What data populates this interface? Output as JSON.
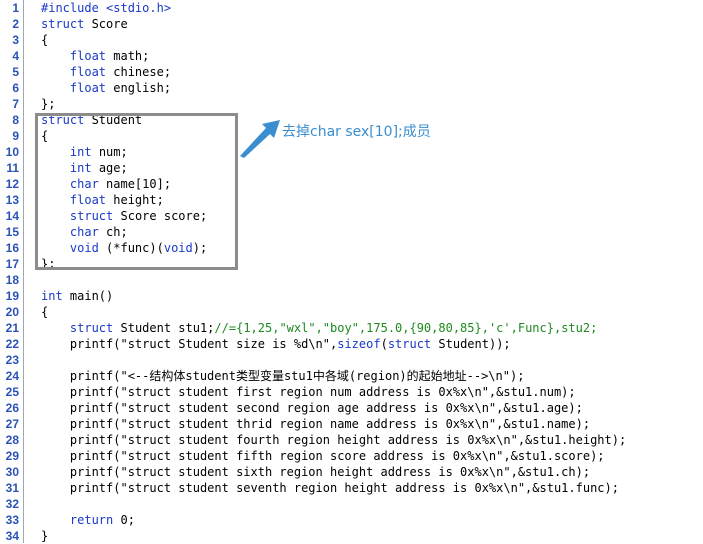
{
  "editor": {
    "lines": [
      {
        "n": "1",
        "segs": [
          {
            "t": "#include <stdio.h>",
            "c": "pp"
          }
        ]
      },
      {
        "n": "2",
        "segs": [
          {
            "t": "struct",
            "c": "kw"
          },
          {
            "t": " Score"
          }
        ]
      },
      {
        "n": "3",
        "segs": [
          {
            "t": "{"
          }
        ]
      },
      {
        "n": "4",
        "segs": [
          {
            "t": "    "
          },
          {
            "t": "float",
            "c": "kw"
          },
          {
            "t": " math;"
          }
        ]
      },
      {
        "n": "5",
        "segs": [
          {
            "t": "    "
          },
          {
            "t": "float",
            "c": "kw"
          },
          {
            "t": " chinese;"
          }
        ]
      },
      {
        "n": "6",
        "segs": [
          {
            "t": "    "
          },
          {
            "t": "float",
            "c": "kw"
          },
          {
            "t": " english;"
          }
        ]
      },
      {
        "n": "7",
        "segs": [
          {
            "t": "};"
          }
        ]
      },
      {
        "n": "8",
        "segs": [
          {
            "t": "struct",
            "c": "kw"
          },
          {
            "t": " Student"
          }
        ]
      },
      {
        "n": "9",
        "segs": [
          {
            "t": "{"
          }
        ]
      },
      {
        "n": "10",
        "segs": [
          {
            "t": "    "
          },
          {
            "t": "int",
            "c": "kw"
          },
          {
            "t": " num;"
          }
        ]
      },
      {
        "n": "11",
        "segs": [
          {
            "t": "    "
          },
          {
            "t": "int",
            "c": "kw"
          },
          {
            "t": " age;"
          }
        ]
      },
      {
        "n": "12",
        "segs": [
          {
            "t": "    "
          },
          {
            "t": "char",
            "c": "kw"
          },
          {
            "t": " name[10];"
          }
        ]
      },
      {
        "n": "13",
        "segs": [
          {
            "t": "    "
          },
          {
            "t": "float",
            "c": "kw"
          },
          {
            "t": " height;"
          }
        ]
      },
      {
        "n": "14",
        "segs": [
          {
            "t": "    "
          },
          {
            "t": "struct",
            "c": "kw"
          },
          {
            "t": " Score score;"
          }
        ]
      },
      {
        "n": "15",
        "segs": [
          {
            "t": "    "
          },
          {
            "t": "char",
            "c": "kw"
          },
          {
            "t": " ch;"
          }
        ]
      },
      {
        "n": "16",
        "segs": [
          {
            "t": "    "
          },
          {
            "t": "void",
            "c": "kw"
          },
          {
            "t": " (*func)("
          },
          {
            "t": "void",
            "c": "kw"
          },
          {
            "t": ");"
          }
        ]
      },
      {
        "n": "17",
        "segs": [
          {
            "t": "};"
          }
        ]
      },
      {
        "n": "18",
        "segs": []
      },
      {
        "n": "19",
        "segs": [
          {
            "t": "int",
            "c": "kw"
          },
          {
            "t": " main()"
          }
        ]
      },
      {
        "n": "20",
        "segs": [
          {
            "t": "{"
          }
        ]
      },
      {
        "n": "21",
        "segs": [
          {
            "t": "    "
          },
          {
            "t": "struct",
            "c": "kw"
          },
          {
            "t": " Student stu1;"
          },
          {
            "t": "//={1,25,\"wxl\",\"boy\",175.0,{90,80,85},'c',Func},stu2;",
            "c": "cm"
          }
        ]
      },
      {
        "n": "22",
        "segs": [
          {
            "t": "    printf(\"struct Student size is %d\\n\","
          },
          {
            "t": "sizeof",
            "c": "kw"
          },
          {
            "t": "("
          },
          {
            "t": "struct",
            "c": "kw"
          },
          {
            "t": " Student));"
          }
        ]
      },
      {
        "n": "23",
        "segs": []
      },
      {
        "n": "24",
        "segs": [
          {
            "t": "    printf(\"<--结构体student类型变量stu1中各域(region)的起始地址-->\\n\");"
          }
        ]
      },
      {
        "n": "25",
        "segs": [
          {
            "t": "    printf(\"struct student first region num address is 0x%x\\n\",&stu1.num);"
          }
        ]
      },
      {
        "n": "26",
        "segs": [
          {
            "t": "    printf(\"struct student second region age address is 0x%x\\n\",&stu1.age);"
          }
        ]
      },
      {
        "n": "27",
        "segs": [
          {
            "t": "    printf(\"struct student thrid region name address is 0x%x\\n\",&stu1.name);"
          }
        ]
      },
      {
        "n": "28",
        "segs": [
          {
            "t": "    printf(\"struct student fourth region height address is 0x%x\\n\",&stu1.height);"
          }
        ]
      },
      {
        "n": "29",
        "segs": [
          {
            "t": "    printf(\"struct student fifth region score address is 0x%x\\n\",&stu1.score);"
          }
        ]
      },
      {
        "n": "30",
        "segs": [
          {
            "t": "    printf(\"struct student sixth region height address is 0x%x\\n\",&stu1.ch);"
          }
        ]
      },
      {
        "n": "31",
        "segs": [
          {
            "t": "    printf(\"struct student seventh region height address is 0x%x\\n\",&stu1.func);"
          }
        ]
      },
      {
        "n": "32",
        "segs": []
      },
      {
        "n": "33",
        "segs": [
          {
            "t": "    "
          },
          {
            "t": "return",
            "c": "kw"
          },
          {
            "t": " 0;"
          }
        ]
      },
      {
        "n": "34",
        "segs": [
          {
            "t": "}"
          }
        ]
      }
    ]
  },
  "annotation": {
    "text": "去掉char sex[10];成员",
    "color": "#3a8ed0",
    "box_color": "#8c8c8c"
  },
  "colors": {
    "keyword": "#1a39c7",
    "comment": "#1e8a1e",
    "line_number": "#2b52b7"
  }
}
